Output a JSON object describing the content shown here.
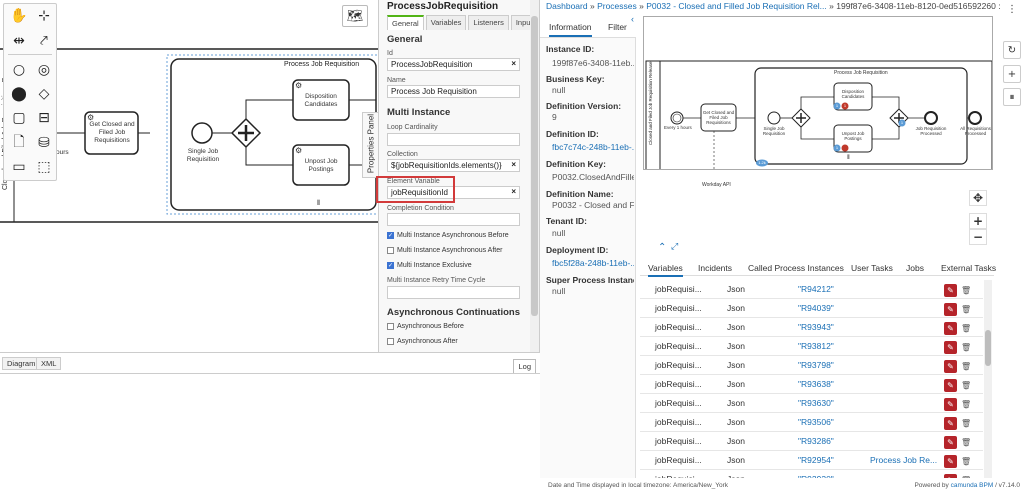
{
  "modeler": {
    "palette": {
      "icons": [
        "hand-tool-icon",
        "lasso-tool-icon",
        "space-tool-icon",
        "global-connect-icon",
        "start-event-icon",
        "intermediate-event-icon",
        "end-event-icon",
        "gateway-icon",
        "task-icon",
        "subprocess-icon",
        "data-object-icon",
        "data-store-icon",
        "participant-icon",
        "group-icon"
      ]
    },
    "canvas": {
      "subprocess_label": "Process Job Requisition",
      "task_get_closed": "Get Closed and Filed Job Requisitions",
      "event_single": "Single Job Requisition",
      "task_disposition": "Disposition Candidates",
      "task_unpost": "Unpost Job Postings",
      "pool_label_fragment": "Closed and Filed Job Requisitions Process",
      "hours_fragment": "ours"
    },
    "properties_tab": "Properties Panel",
    "properties": {
      "title": "ProcessJobRequisition",
      "tabs": [
        "General",
        "Variables",
        "Listeners",
        "Input/O"
      ],
      "general_heading": "General",
      "id_label": "Id",
      "id_value": "ProcessJobRequisition",
      "name_label": "Name",
      "name_value": "Process Job Requisition",
      "multi_heading": "Multi Instance",
      "loop_label": "Loop Cardinality",
      "loop_value": "",
      "collection_label": "Collection",
      "collection_value": "${jobRequisitionIds.elements()}",
      "element_var_label": "Element Variable",
      "element_var_value": "jobRequisitionId",
      "completion_label": "Completion Condition",
      "completion_value": "",
      "async_before_label": "Multi Instance Asynchronous Before",
      "async_after_label": "Multi Instance Asynchronous After",
      "exclusive_label": "Multi Instance Exclusive",
      "retry_label": "Multi Instance Retry Time Cycle",
      "retry_value": "",
      "async_heading": "Asynchronous Continuations",
      "ac_before_label": "Asynchronous Before",
      "ac_after_label": "Asynchronous After",
      "clear": "×"
    },
    "bottom_tabs": [
      "Diagram",
      "XML"
    ],
    "log_button": "Log"
  },
  "cockpit": {
    "breadcrumb": {
      "dashboard": "Dashboard",
      "sep": "»",
      "processes": "Processes",
      "definition": "P0032 - Closed and Filled Job Requisition Rel...",
      "instance": "199f87e6-3408-11eb-8120-0ed516592260 : Runtime"
    },
    "info_tabs": [
      "Information",
      "Filter"
    ],
    "info": [
      {
        "label": "Instance ID:",
        "value": "199f87e6-3408-11eb...",
        "link": false
      },
      {
        "label": "Business Key:",
        "value": "null",
        "link": false
      },
      {
        "label": "Definition Version:",
        "value": "9",
        "link": false
      },
      {
        "label": "Definition ID:",
        "value": "fbc7c74c-248b-11eb-...",
        "link": true
      },
      {
        "label": "Definition Key:",
        "value": "P0032.ClosedAndFille...",
        "link": false
      },
      {
        "label": "Definition Name:",
        "value": "P0032 - Closed and Fil...",
        "link": false
      },
      {
        "label": "Tenant ID:",
        "value": "null",
        "link": false
      },
      {
        "label": "Deployment ID:",
        "value": "fbc5f28a-248b-11eb-...",
        "link": true
      },
      {
        "label": "Super Process Instanc...",
        "value": "null",
        "link": false
      }
    ],
    "diagram": {
      "subprocess_label": "Process Job Requisition",
      "pool_label": "Closed and Filed Job Requisition Release",
      "timer_label": "Every 1 hours",
      "task_get": "Get Closed and Filed Job Requisitions",
      "single_label": "Single Job Requisition",
      "task_disposition": "Disposition Candidates",
      "task_unpost": "Unpost Job Postings",
      "processed_label": "Job Requisition Processed",
      "all_processed_label": "All Requisitions Processed",
      "workday": "Workday API",
      "badge_1": "1",
      "badge_2": "1",
      "badge_3": "1",
      "badge_4": "1",
      "badge_big": "1.2k"
    },
    "var_tabs": [
      "Variables",
      "Incidents",
      "Called Process Instances",
      "User Tasks",
      "Jobs",
      "External Tasks"
    ],
    "variables": [
      {
        "name": "jobRequisi...",
        "type": "Json",
        "value": "\"R94212\"",
        "scope": ""
      },
      {
        "name": "jobRequisi...",
        "type": "Json",
        "value": "\"R94039\"",
        "scope": ""
      },
      {
        "name": "jobRequisi...",
        "type": "Json",
        "value": "\"R93943\"",
        "scope": ""
      },
      {
        "name": "jobRequisi...",
        "type": "Json",
        "value": "\"R93812\"",
        "scope": ""
      },
      {
        "name": "jobRequisi...",
        "type": "Json",
        "value": "\"R93798\"",
        "scope": ""
      },
      {
        "name": "jobRequisi...",
        "type": "Json",
        "value": "\"R93638\"",
        "scope": ""
      },
      {
        "name": "jobRequisi...",
        "type": "Json",
        "value": "\"R93630\"",
        "scope": ""
      },
      {
        "name": "jobRequisi...",
        "type": "Json",
        "value": "\"R93506\"",
        "scope": ""
      },
      {
        "name": "jobRequisi...",
        "type": "Json",
        "value": "\"R93286\"",
        "scope": ""
      },
      {
        "name": "jobRequisi...",
        "type": "Json",
        "value": "\"R92954\"",
        "scope": "Process Job Re..."
      },
      {
        "name": "jobRequisi...",
        "type": "Json",
        "value": "\"R92930\"",
        "scope": ""
      }
    ],
    "footer_left": "Date and Time displayed in local timezone: America/New_York",
    "footer_right_prefix": "Powered by",
    "footer_brand": "camunda BPM",
    "footer_version": "/ v7.14.0"
  },
  "colors": {
    "accent": "#1a6fb5",
    "highlight": "#d23a3a",
    "edit": "#b5242a",
    "checkbox": "#3b73d2"
  }
}
